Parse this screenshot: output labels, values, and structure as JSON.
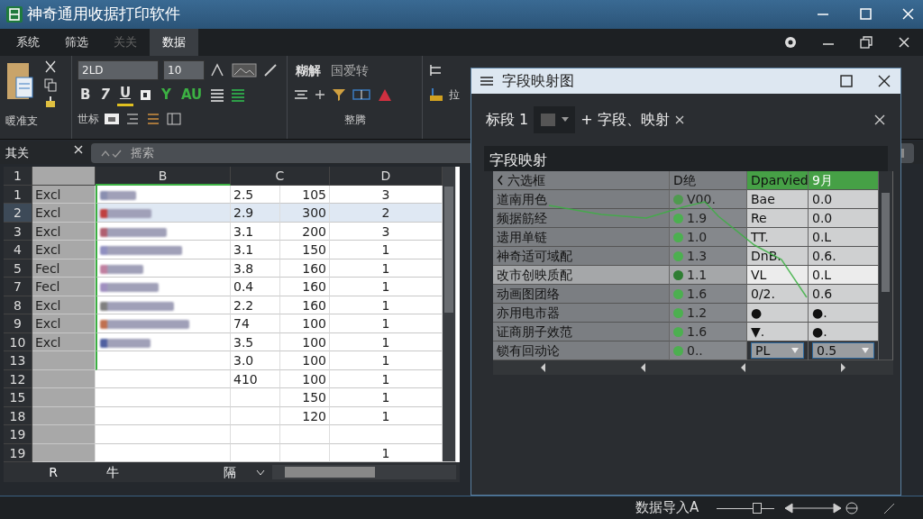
{
  "window": {
    "title": "神奇通用收据打印软件"
  },
  "menu_tabs": [
    {
      "label": "系统",
      "selected": false,
      "disabled": false
    },
    {
      "label": "筛选",
      "selected": false,
      "disabled": false
    },
    {
      "label": "关关",
      "selected": false,
      "disabled": true
    },
    {
      "label": "数据",
      "selected": true,
      "disabled": false
    }
  ],
  "ribbon": {
    "clipboard_label": "暖准支",
    "font_name": "2LD",
    "font_size": "10",
    "format_buttons": [
      "B",
      "7",
      "U"
    ],
    "color_buttons": [
      "Y",
      "AU"
    ],
    "row3_label": "世标",
    "big_buttons": [
      "糊解",
      "国爱转"
    ],
    "group_label": "整腾",
    "right_label": "拉"
  },
  "formula_bar": {
    "name_box": "其关",
    "formula": "摇索"
  },
  "sheet": {
    "columns": [
      "1",
      "",
      "B",
      "C",
      "D"
    ],
    "rows": [
      {
        "num": "1",
        "a": "Excl",
        "blurred": true,
        "c1": "2.5",
        "c2": "105",
        "d": "3",
        "selected": false
      },
      {
        "num": "2",
        "a": "Excl",
        "blurred": true,
        "c1": "2.9",
        "c2": "300",
        "d": "2",
        "selected": true
      },
      {
        "num": "3",
        "a": "Excl",
        "blurred": true,
        "c1": "3.1",
        "c2": "200",
        "d": "3",
        "selected": false
      },
      {
        "num": "4",
        "a": "Excl",
        "blurred": true,
        "c1": "3.1",
        "c2": "150",
        "d": "1",
        "selected": false
      },
      {
        "num": "5",
        "a": "Fecl",
        "blurred": true,
        "c1": "3.8",
        "c2": "160",
        "d": "1",
        "selected": false
      },
      {
        "num": "7",
        "a": "Fecl",
        "blurred": true,
        "c1": "0.4",
        "c2": "160",
        "d": "1",
        "selected": false
      },
      {
        "num": "8",
        "a": "Excl",
        "blurred": true,
        "c1": "2.2",
        "c2": "160",
        "d": "1",
        "selected": false
      },
      {
        "num": "9",
        "a": "Excl",
        "blurred": true,
        "c1": "74",
        "c2": "100",
        "d": "1",
        "selected": false
      },
      {
        "num": "10",
        "a": "Excl",
        "blurred": true,
        "c1": "3.5",
        "c2": "100",
        "d": "1",
        "selected": false
      },
      {
        "num": "13",
        "a": "",
        "blurred": false,
        "c1": "3.0",
        "c2": "100",
        "d": "1",
        "selected": false
      },
      {
        "num": "12",
        "a": "",
        "blurred": false,
        "c1": "410",
        "c2": "100",
        "d": "1",
        "selected": false
      },
      {
        "num": "15",
        "a": "",
        "blurred": false,
        "c1": "",
        "c2": "150",
        "d": "1",
        "selected": false
      },
      {
        "num": "18",
        "a": "",
        "blurred": false,
        "c1": "",
        "c2": "120",
        "d": "1",
        "selected": false
      },
      {
        "num": "19",
        "a": "",
        "blurred": false,
        "c1": "",
        "c2": "",
        "d": "",
        "selected": false
      },
      {
        "num": "19",
        "a": "",
        "blurred": false,
        "c1": "",
        "c2": "",
        "d": "1",
        "selected": false
      }
    ],
    "sheet_tabs": [
      "R",
      "牛",
      "隔"
    ]
  },
  "dialog": {
    "title": "字段映射图",
    "filter_label": "标段 1",
    "chip": "+ 字段、映射",
    "section": "字段映射",
    "columns": [
      "六选框",
      "D绝",
      "Dparvied",
      "9月"
    ],
    "rows": [
      {
        "kind": "text",
        "name": "道南用色",
        "value": "V00.",
        "color": "#4f9a4f",
        "col3": "Bae",
        "col4": "0.0",
        "selected": false
      },
      {
        "kind": "text",
        "name": "频据筋经",
        "value": "1.9",
        "color": "#4caf50",
        "col3": "Re",
        "col4": "0.0",
        "selected": false
      },
      {
        "kind": "text",
        "name": "遗用单链",
        "value": "1.0",
        "color": "#4caf50",
        "col3": "TT.",
        "col4": "0.L",
        "selected": false
      },
      {
        "kind": "text",
        "name": "神奇适可域配",
        "value": "1.3",
        "color": "#4caf50",
        "col3": "DnB.",
        "col4": "0.6.",
        "selected": false
      },
      {
        "kind": "text",
        "name": "改市创映质配",
        "value": "1.1",
        "color": "#2e7d32",
        "col3": "VL",
        "col4": "0.L",
        "selected": true
      },
      {
        "kind": "text",
        "name": "动画图团络",
        "value": "1.6",
        "color": "#4caf50",
        "col3": "0/2.",
        "col4": "0.6",
        "selected": false
      },
      {
        "kind": "text",
        "name": "亦用电市器",
        "value": "1.2",
        "color": "#4caf50",
        "col3": "●",
        "col4": "●.",
        "selected": false
      },
      {
        "kind": "text",
        "name": "证商朋子效范",
        "value": "1.6",
        "color": "#4caf50",
        "col3": "▼.",
        "col4": "●.",
        "selected": false
      },
      {
        "kind": "dropdown",
        "name": "锁有回动论",
        "value": "0..",
        "color": "#4caf50",
        "col3": "PL",
        "col4": "0.5",
        "selected": false
      }
    ]
  },
  "status_bar": {
    "text": "数据导入A",
    "zoom": {
      "level": 0.7
    }
  }
}
